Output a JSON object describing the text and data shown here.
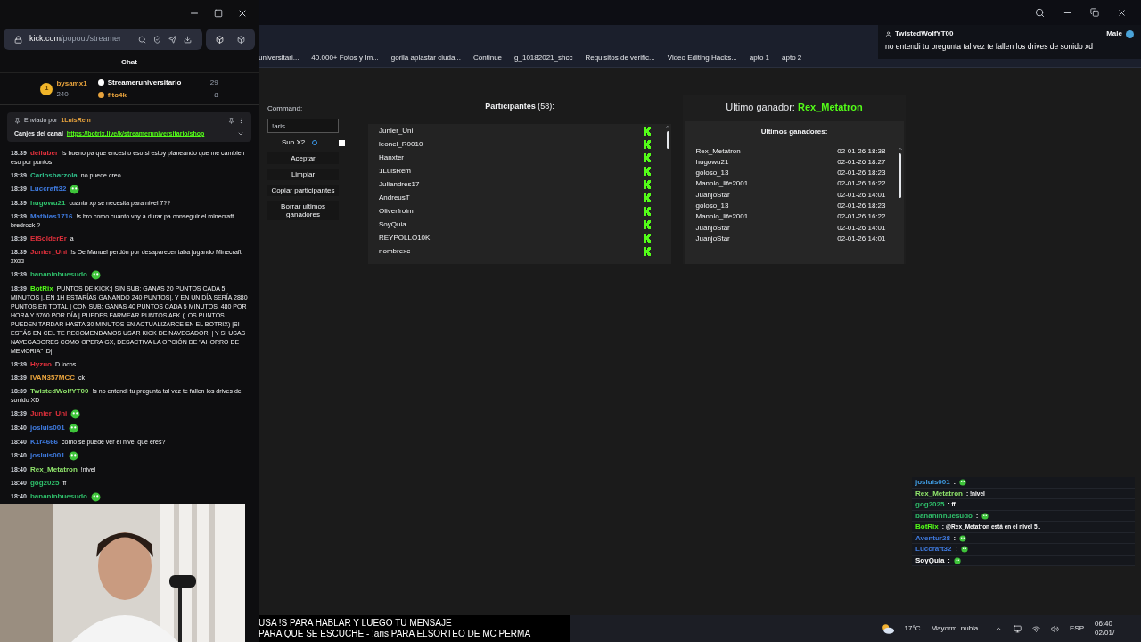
{
  "popout": {
    "url_host": "kick.com",
    "url_path": "/popout/streamer",
    "chat_title": "Chat",
    "gifters": [
      {
        "rank": "1",
        "name": "bysamx1",
        "count": "240",
        "color": "#e8a33d"
      },
      {
        "name": "Streameruniversitario",
        "count": "29",
        "color": "#ffffff"
      },
      {
        "name": "fito4k",
        "count": "8",
        "color": "#e8a33d"
      }
    ],
    "pinned": {
      "label": "Enviado por",
      "user": "1LuisRem",
      "text": "Canjes del canal",
      "link": "https://botrix.live/k/streameruniversitario/shop"
    },
    "messages": [
      {
        "time": "18:39",
        "user": "deiluber",
        "color": "#e0303c",
        "text": "!s bueno pa que encesito eso si estoy planeando que me cambien eso por puntos"
      },
      {
        "time": "18:39",
        "user": "Carlosbarzola",
        "color": "#2fbf8a",
        "text": "no puede creo"
      },
      {
        "time": "18:39",
        "user": "Luccraft32",
        "color": "#3f7be0",
        "emote": true
      },
      {
        "time": "18:39",
        "user": "hugowu21",
        "color": "#2fbf6a",
        "text": "cuanto xp se necesita para nivel 7??"
      },
      {
        "time": "18:39",
        "user": "Mathias1716",
        "color": "#3f7be0",
        "text": "!s bro como cuanto voy a durar pa conseguir el minecraft bredrock ?"
      },
      {
        "time": "18:39",
        "user": "ElSolderEr",
        "color": "#e0303c",
        "text": "a"
      },
      {
        "time": "18:39",
        "user": "Junier_Uni",
        "color": "#e0303c",
        "text": "!s Oe Manuel perdón por desaparecer taba jugando Minecraft xxdd"
      },
      {
        "time": "18:39",
        "user": "bananinhuesudo",
        "color": "#2fbf6a",
        "emote": true
      },
      {
        "time": "18:39",
        "user": "BotRix",
        "color": "#53fc18",
        "text": "PUNTOS DE KICK:| SIN SUB: GANAS 20 PUNTOS CADA 5 MINUTOS |, EN 1H ESTARÍAS GANANDO 240 PUNTOS|, Y EN UN DÍA SERÍA 2880 PUNTOS EN TOTAL | CON SUB: GANAS 40 PUNTOS CADA 5 MINUTOS, 480 POR HORA Y 5760 POR DÍA | PUEDES FARMEAR PUNTOS AFK.(LOS PUNTOS PUEDEN TARDAR HASTA 30 MINUTOS EN ACTUALIZARCE EN EL BOTRIX) |SI ESTÁS EN CEL TE RECOMENDAMOS USAR KICK DE NAVEGADOR. | Y SI USAS NAVEGADORES COMO OPERA GX, DESACTIVA LA OPCIÓN DE \"AHORRO DE MEMORIA\" :D|"
      },
      {
        "time": "18:39",
        "user": "Hyzuo",
        "color": "#e0303c",
        "text": "D locos"
      },
      {
        "time": "18:39",
        "user": "IVAN357MCC",
        "color": "#e8a33d",
        "text": "ck"
      },
      {
        "time": "18:39",
        "user": "TwistedWolfYT00",
        "color": "#8fe36b",
        "text": "!s no entendi tu pregunta tal vez te fallen los drives de sonido XD"
      },
      {
        "time": "18:39",
        "user": "Junier_Uni",
        "color": "#e0303c",
        "emote": true
      },
      {
        "time": "18:40",
        "user": "josluis001",
        "color": "#3f7be0",
        "emote": true
      },
      {
        "time": "18:40",
        "user": "K1r4666",
        "color": "#3f7be0",
        "text": "como se puede ver el nivel que eres?"
      },
      {
        "time": "18:40",
        "user": "josluis001",
        "color": "#3f7be0",
        "emote": true
      },
      {
        "time": "18:40",
        "user": "Rex_Metatron",
        "color": "#8fe36b",
        "text": "!nivel"
      },
      {
        "time": "18:40",
        "user": "gog2025",
        "color": "#2fbf6a",
        "text": "ff"
      },
      {
        "time": "18:40",
        "user": "bananinhuesudo",
        "color": "#2fbf6a",
        "emote": true
      }
    ]
  },
  "bookmarks": [
    "universitari...",
    "40.000+ Fotos y Im...",
    "gorila aplastar ciuda...",
    "Continue",
    "g_10182021_shcc",
    "Requisitos de verific...",
    "Video Editing Hacks...",
    "apto 1",
    "apto 2"
  ],
  "notification": {
    "user": "TwistedWolfYT00",
    "voice": "Male",
    "text": "no entendi tu pregunta tal vez te fallen los drives de sonido xd"
  },
  "giveaway": {
    "command_label": "Command:",
    "command_value": "!aris",
    "sub_label": "Sub X2",
    "sub_checked": false,
    "buttons": [
      "Aceptar",
      "Limpiar",
      "Copiar participantes",
      "Borrar ultimos ganadores"
    ],
    "participants_title": "Participantes",
    "participants_count": "(58):",
    "participants": [
      "Junier_Uni",
      "leonel_R0010",
      "Hanxter",
      "1LuisRem",
      "Juliandres17",
      "AndreusT",
      "Oliverfroim",
      "SoyQuia",
      "REYPOLLO10K",
      "nombrexc"
    ],
    "last_winner_label": "Ultimo ganador:",
    "last_winner": "Rex_Metatron",
    "winners_title": "Ultimos ganadores:",
    "winners": [
      {
        "name": "Rex_Metatron",
        "date": "02-01-26 18:38"
      },
      {
        "name": "hugowu21",
        "date": "02-01-26 18:27"
      },
      {
        "name": "goloso_13",
        "date": "02-01-26 18:23"
      },
      {
        "name": "Manolo_life2001",
        "date": "02-01-26 16:22"
      },
      {
        "name": "JuanjoStar",
        "date": "02-01-26 14:01"
      },
      {
        "name": "goloso_13",
        "date": "02-01-26 18:23"
      },
      {
        "name": "Manolo_life2001",
        "date": "02-01-26 16:22"
      },
      {
        "name": "JuanjoStar",
        "date": "02-01-26 14:01"
      },
      {
        "name": "JuanjoStar",
        "date": "02-01-26 14:01"
      }
    ]
  },
  "overlay_chat": [
    {
      "user": "josluis001",
      "color": "#3f9be0",
      "text": ":",
      "emote": true
    },
    {
      "user": "Rex_Metatron",
      "color": "#8fe36b",
      "text": ": !nivel"
    },
    {
      "user": "gog2025",
      "color": "#2fbf6a",
      "text": ": ff"
    },
    {
      "user": "bananinhuesudo",
      "color": "#2fbf6a",
      "text": ":",
      "emote": true
    },
    {
      "user": "BotRix",
      "color": "#53fc18",
      "text": ": @Rex_Metatron está en el nivel 5 ."
    },
    {
      "user": "Aventur28",
      "color": "#3f7be0",
      "text": ":",
      "emote": true
    },
    {
      "user": "Luccraft32",
      "color": "#3f7be0",
      "text": ":",
      "emote": true
    },
    {
      "user": "SoyQuia",
      "color": "#ffffff",
      "text": ":",
      "emote": true
    }
  ],
  "subtitle": [
    "USA !S PARA HABLAR Y LUEGO TU MENSAJE",
    "PARA QUE SE ESCUCHE - !aris PARA ELSORTEO DE MC PERMA"
  ],
  "taskbar": {
    "temperature": "17°C",
    "weather": "Mayorm. nubla...",
    "language": "ESP",
    "time": "06:40",
    "date": "02/01/"
  }
}
